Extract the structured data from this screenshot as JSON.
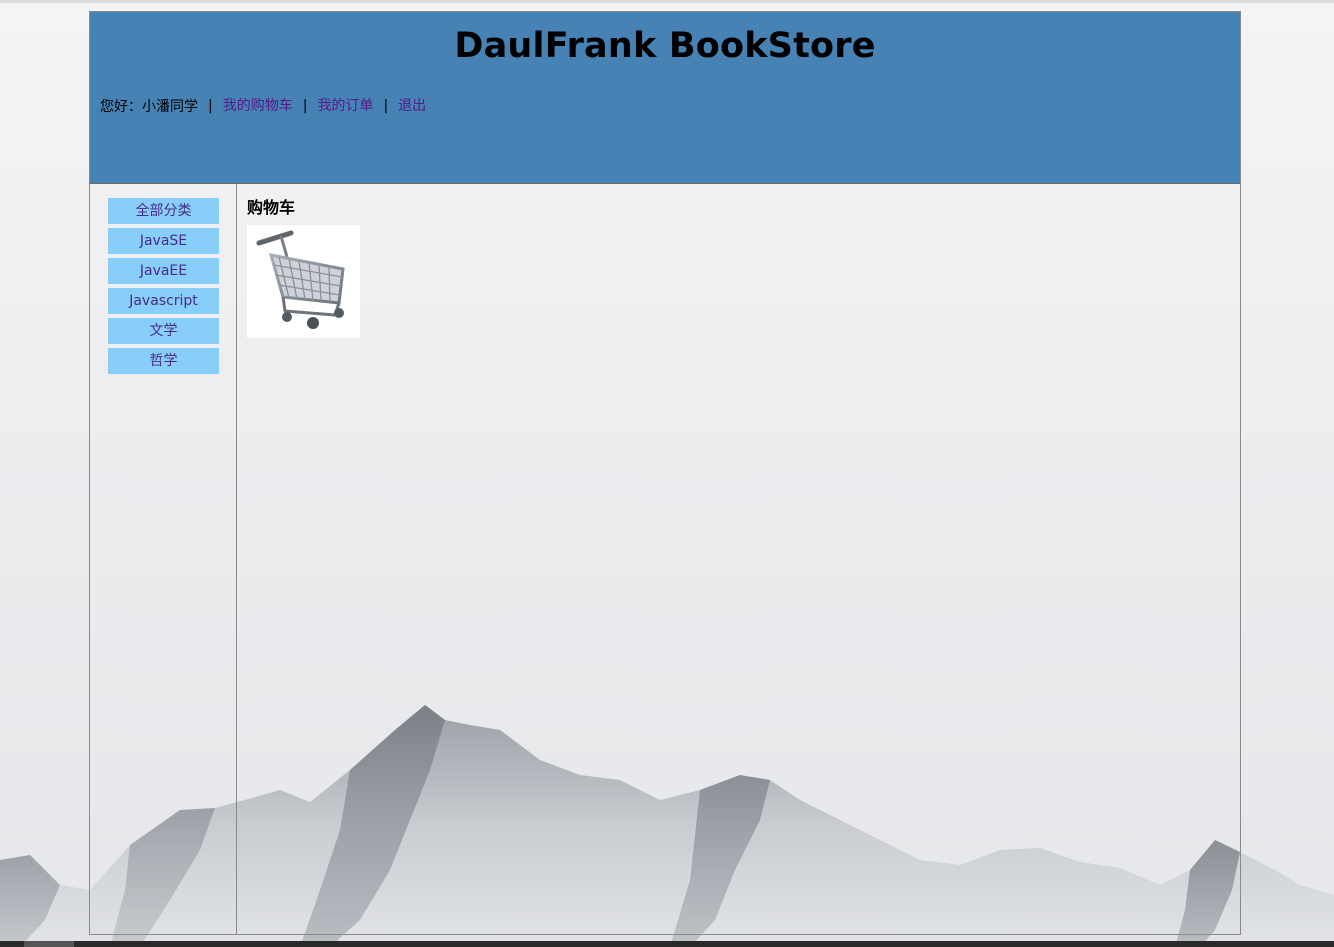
{
  "header": {
    "title": "DaulFrank BookStore",
    "greeting": "您好：小潘同学",
    "separator": "|",
    "links": {
      "cart": "我的购物车",
      "orders": "我的订单",
      "logout": "退出"
    }
  },
  "sidebar": {
    "categories": [
      "全部分类",
      "JavaSE",
      "JavaEE",
      "Javascript",
      "文学",
      "哲学"
    ]
  },
  "main": {
    "title": "购物车",
    "cart_icon": "shopping-cart-icon"
  },
  "colors": {
    "header_bg": "#4682b4",
    "category_bg": "#87cefa",
    "link": "#551a8b"
  }
}
